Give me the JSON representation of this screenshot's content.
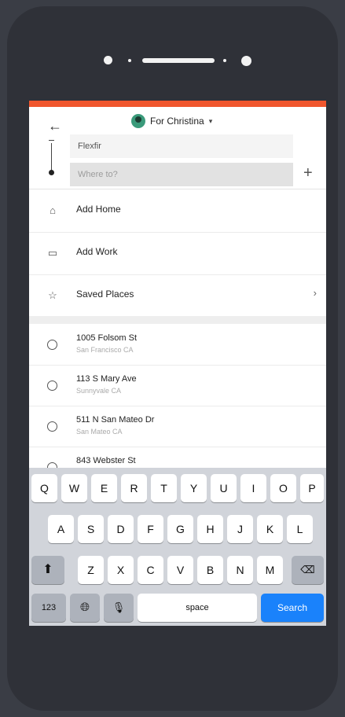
{
  "header": {
    "back_icon": "arrow-left-icon",
    "rider_label": "For Christina",
    "from_value": "Flexfir",
    "to_placeholder": "Where to?"
  },
  "menu": [
    {
      "icon": "home-icon",
      "label": "Add Home"
    },
    {
      "icon": "briefcase-icon",
      "label": "Add Work"
    },
    {
      "icon": "star-icon",
      "label": "Saved Places"
    }
  ],
  "recent": [
    {
      "title": "1005 Folsom St",
      "subtitle": "San Francisco CA"
    },
    {
      "title": "113 S Mary Ave",
      "subtitle": "Sunnyvale CA"
    },
    {
      "title": "511 N San Mateo Dr",
      "subtitle": "San Mateo CA"
    },
    {
      "title": "843 Webster St",
      "subtitle": ""
    }
  ],
  "keyboard": {
    "row1": [
      "Q",
      "W",
      "E",
      "R",
      "T",
      "Y",
      "U",
      "I",
      "O",
      "P"
    ],
    "row2": [
      "A",
      "S",
      "D",
      "F",
      "G",
      "H",
      "J",
      "K",
      "L"
    ],
    "row3": [
      "Z",
      "X",
      "C",
      "V",
      "B",
      "N",
      "M"
    ],
    "numbers_label": "123",
    "space_label": "space",
    "search_label": "Search"
  },
  "colors": {
    "accent": "#f0562d",
    "search_key": "#1a82fb",
    "device": "#2f3138"
  }
}
